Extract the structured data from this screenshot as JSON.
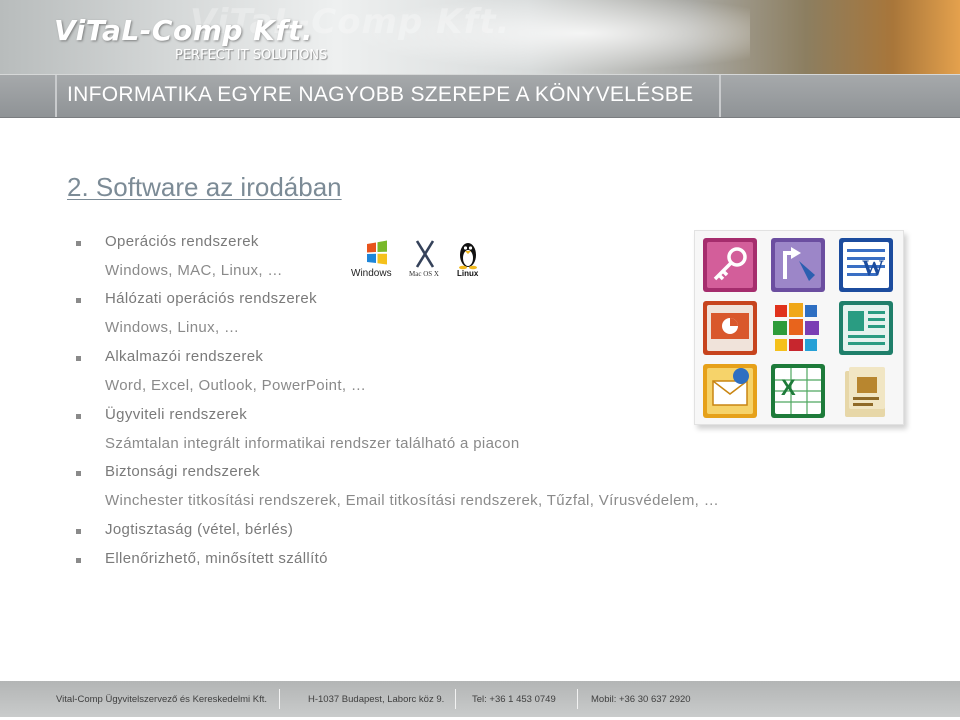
{
  "header": {
    "logo": "ViTaL-Comp Kft.",
    "tagline": "PERFECT IT SOLUTIONS"
  },
  "slide": {
    "title": "INFORMATIKA EGYRE NAGYOBB SZEREPE A KÖNYVELÉSBE",
    "heading": "2. Software az irodában",
    "items": [
      {
        "text": "Operációs rendszerek",
        "detail": "Windows, MAC, Linux, …"
      },
      {
        "text": "Hálózati operációs rendszerek",
        "detail": "Windows, Linux, …"
      },
      {
        "text": "Alkalmazói rendszerek",
        "detail": "Word, Excel, Outlook, PowerPoint, …"
      },
      {
        "text": "Ügyviteli rendszerek",
        "detail": "Számtalan integrált informatikai rendszer található a piacon"
      },
      {
        "text": "Biztonsági rendszerek",
        "detail": "Winchester titkosítási rendszerek, Email titkosítási rendszerek, Tűzfal, Vírusvédelem, …"
      },
      {
        "text": "Jogtisztaság (vétel, bérlés)"
      },
      {
        "text": "Ellenőrizhető, minősített szállító"
      }
    ]
  },
  "os_logos": [
    {
      "label": "Windows",
      "icon": "windows-flag-icon"
    },
    {
      "label": "Mac OS X",
      "icon": "mac-os-x-icon"
    },
    {
      "label": "Linux",
      "icon": "tux-penguin-icon"
    }
  ],
  "app_icons": [
    "access-icon",
    "infopath-icon",
    "word-icon",
    "powerpoint-icon",
    "office-icon",
    "publisher-icon",
    "outlook-icon",
    "excel-icon",
    "frontpage-icon"
  ],
  "footer": {
    "company": "Vital-Comp Ügyvitelszervező és Kereskedelmi Kft.",
    "address": "H-1037 Budapest, Laborc köz 9.",
    "phone": "Tel: +36 1 453 0749",
    "mobile": "Mobil: +36 30 637 2920"
  },
  "colors": {
    "title_bar": "#9a9ea1",
    "heading": "#7c8b96",
    "body_text": "#8a8a8a"
  }
}
